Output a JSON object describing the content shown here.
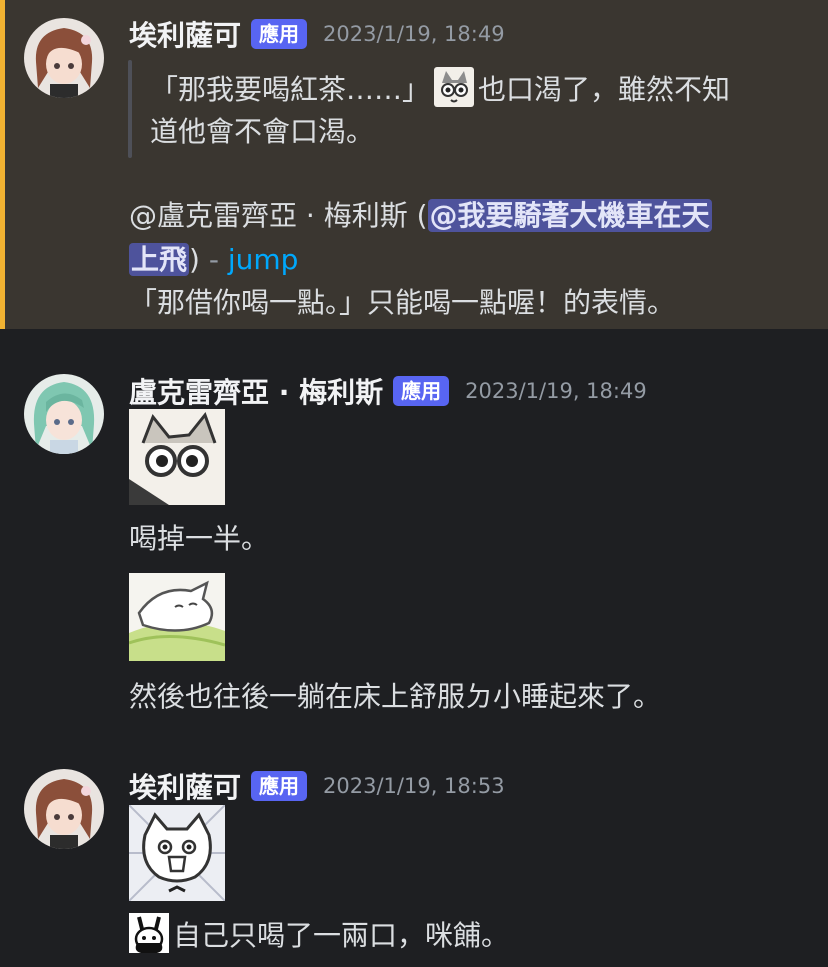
{
  "messages": [
    {
      "username": "埃利薩可",
      "badge": "應用",
      "timestamp": "2023/1/19, 18:49",
      "quote_line1_a": "「那我要喝紅茶……」",
      "quote_line1_b": "也口渴了，雖然不知",
      "quote_line2": "道他會不會口渴。",
      "reply_prefix": "@盧克雷齊亞 · 梅利斯 (",
      "mention_line1": "@我要騎著大機車在天",
      "mention_line2": "上飛",
      "reply_close": ")",
      "dash": " - ",
      "jump_link": "jump",
      "body": "「那借你喝一點。」只能喝一點喔！的表情。"
    },
    {
      "username": "盧克雷齊亞 · 梅利斯",
      "badge": "應用",
      "timestamp": "2023/1/19, 18:49",
      "text1": "喝掉一半。",
      "text2": "然後也往後一躺在床上舒服ㄉ小睡起來了。"
    },
    {
      "username": "埃利薩可",
      "badge": "應用",
      "timestamp": "2023/1/19, 18:53",
      "text1": "自己只喝了一兩口，咪餔。"
    }
  ],
  "icons": {
    "avatar_1": "brown-haired-girl-avatar",
    "avatar_2": "green-haired-girl-avatar",
    "inline_emote": "cat-face-emote",
    "sticker_1": "cat-eyes-sticker",
    "sticker_2": "lying-cat-sticker",
    "sticker_3": "shocked-cat-sticker",
    "inline_emote_2": "bunny-face-emote"
  },
  "colors": {
    "background": "#1e1f22",
    "highlight_bg": "#3a3630",
    "highlight_accent": "#f0b232",
    "badge": "#5865f2",
    "mention": "#4e539c",
    "link": "#00a8fc"
  }
}
